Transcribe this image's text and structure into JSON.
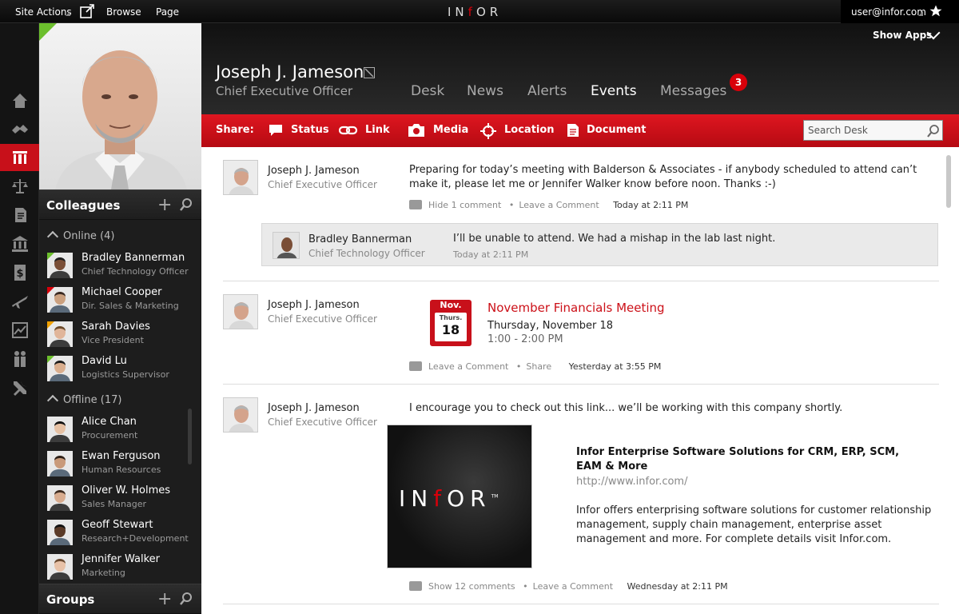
{
  "topbar": {
    "site_actions": "Site Actions",
    "browse": "Browse",
    "page": "Page",
    "logo_prefix": "IN",
    "logo_red": "f",
    "logo_suffix": "OR",
    "user_email": "user@infor.com"
  },
  "rail": {
    "icons": [
      "home-icon",
      "handshake-icon",
      "desk-icon",
      "scales-icon",
      "documents-icon",
      "bank-icon",
      "dollar-icon",
      "plane-icon",
      "chart-icon",
      "people-icon",
      "tools-icon"
    ],
    "active": "desk-icon"
  },
  "colleagues": {
    "title": "Colleagues",
    "online_label": "Online (4)",
    "offline_label": "Offline (17)",
    "online": [
      {
        "name": "Bradley Bannerman",
        "role": "Chief Technology Officer",
        "status": "green"
      },
      {
        "name": "Michael Cooper",
        "role": "Dir. Sales & Marketing",
        "status": "red"
      },
      {
        "name": "Sarah Davies",
        "role": "Vice President",
        "status": "amber"
      },
      {
        "name": "David Lu",
        "role": "Logistics Supervisor",
        "status": "green"
      }
    ],
    "offline": [
      {
        "name": "Alice Chan",
        "role": "Procurement"
      },
      {
        "name": "Ewan Ferguson",
        "role": "Human Resources"
      },
      {
        "name": "Oliver W. Holmes",
        "role": "Sales Manager"
      },
      {
        "name": "Geoff Stewart",
        "role": "Research+Development"
      },
      {
        "name": "Jennifer Walker",
        "role": "Marketing"
      }
    ]
  },
  "groups": {
    "title": "Groups"
  },
  "header": {
    "show_apps": "Show Apps",
    "name": "Joseph J. Jameson",
    "title": "Chief Executive Officer",
    "tabs": [
      "Desk",
      "News",
      "Alerts",
      "Events",
      "Messages"
    ],
    "active_tab": "Events",
    "messages_badge": "3"
  },
  "share": {
    "label": "Share:",
    "items": [
      "Status",
      "Link",
      "Media",
      "Location",
      "Document"
    ],
    "search_placeholder": "Search Desk"
  },
  "feed": {
    "posts": [
      {
        "author": "Joseph J. Jameson",
        "role": "Chief Executive Officer",
        "text": "Preparing for today’s meeting with Balderson & Associates - if anybody scheduled to attend can’t make it, please let me or Jennifer Walker know before noon. Thanks :-)",
        "comments_link": "Hide 1 comment",
        "leave_comment": "Leave a Comment",
        "time": "Today at 2:11 PM",
        "reply": {
          "author": "Bradley Bannerman",
          "role": "Chief Technology Officer",
          "text": "I’ll be unable to attend. We had a mishap in the lab last night.",
          "time": "Today at 2:11 PM"
        }
      },
      {
        "author": "Joseph J. Jameson",
        "role": "Chief Executive Officer",
        "event_title": "November Financials Meeting",
        "calendar_month": "Nov.",
        "calendar_day": "Thurs.",
        "calendar_date": "18",
        "event_date": "Thursday, November 18",
        "event_time": "1:00 - 2:00 PM",
        "leave_comment": "Leave a Comment",
        "share": "Share",
        "time": "Yesterday at 3:55 PM"
      },
      {
        "author": "Joseph J. Jameson",
        "role": "Chief Executive Officer",
        "text": "I encourage you to check out this link... we’ll be working with this company shortly.",
        "link_title": "Infor Enterprise Software Solutions for CRM, ERP, SCM, EAM & More",
        "link_url": "http://www.infor.com/",
        "link_desc": "Infor offers enterprising software solutions for customer relationship management, supply chain management, enterprise asset management and more. For complete details visit Infor.com.",
        "image_word_prefix": "IN",
        "image_word_red": "f",
        "image_word_suffix": "OR",
        "image_tm": "TM",
        "comments_link": "Show 12 comments",
        "leave_comment": "Leave a Comment",
        "time": "Wednesday at 2:11 PM"
      }
    ],
    "separator": "•"
  }
}
